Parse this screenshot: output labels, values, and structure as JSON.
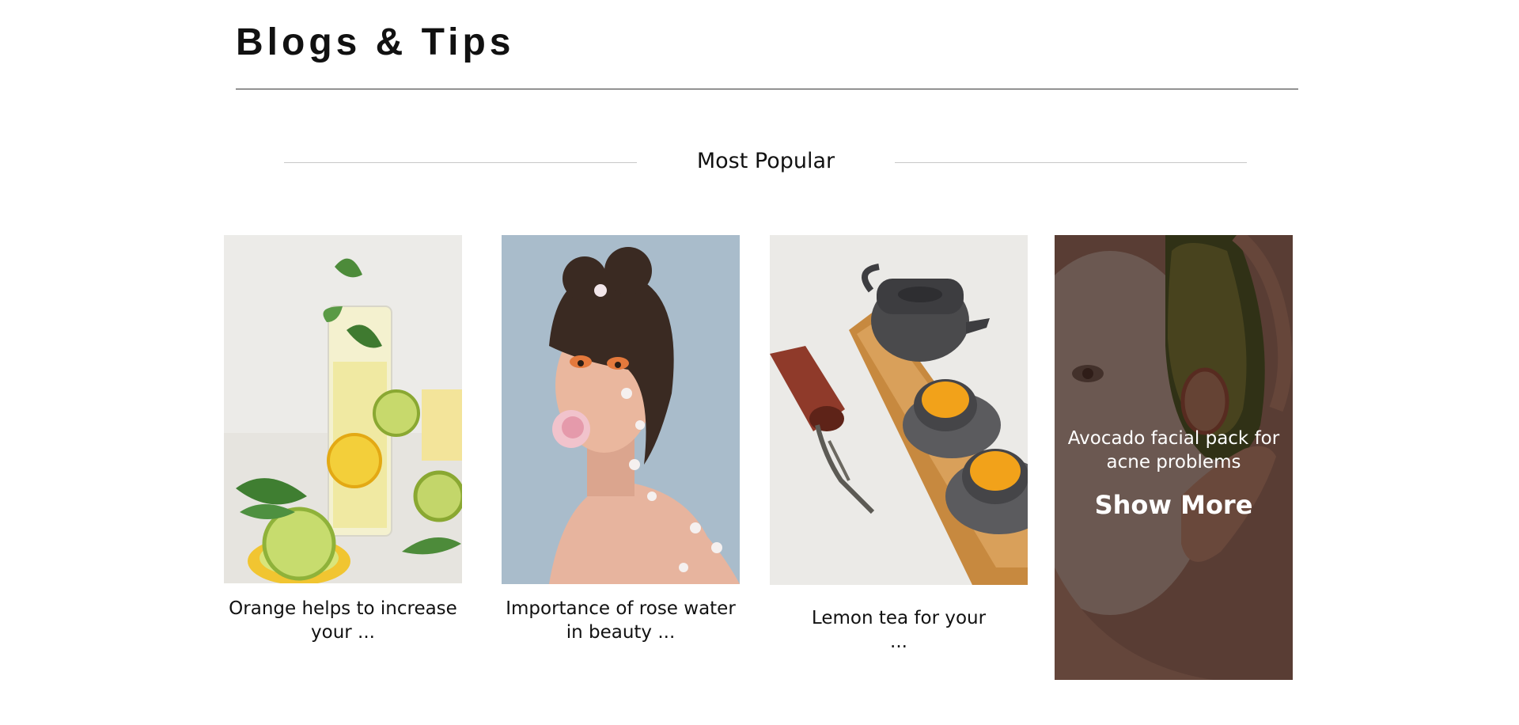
{
  "header": {
    "title": "Blogs & Tips"
  },
  "section": {
    "heading": "Most Popular"
  },
  "cards": [
    {
      "caption_line1": "Orange helps to increase",
      "caption_line2": "your ..."
    },
    {
      "caption_line1": "Importance of rose water",
      "caption_line2": "in beauty ..."
    },
    {
      "caption_line1": "Lemon tea for your",
      "caption_line2": "..."
    }
  ],
  "featured": {
    "title_line1": "Avocado facial pack for",
    "title_line2": "acne problems",
    "show_more_label": "Show More"
  }
}
